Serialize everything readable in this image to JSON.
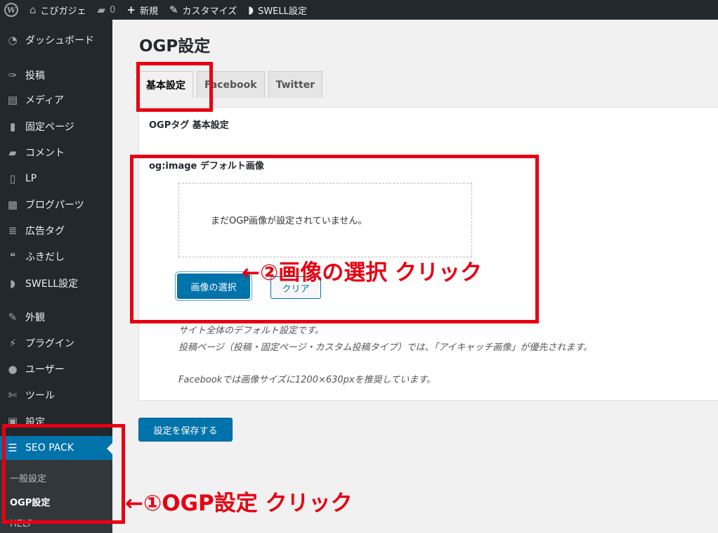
{
  "admin_bar": {
    "site_name": "こびガジェ",
    "comment_count": "0",
    "new_label": "新規",
    "customize_label": "カスタマイズ",
    "swell_label": "SWELL設定"
  },
  "sidebar": {
    "items": [
      {
        "label": "ダッシュボード",
        "icon": "dashboard-icon"
      },
      {
        "label": "投稿",
        "icon": "pin-icon"
      },
      {
        "label": "メディア",
        "icon": "media-icon"
      },
      {
        "label": "固定ページ",
        "icon": "page-icon"
      },
      {
        "label": "コメント",
        "icon": "comment-icon"
      },
      {
        "label": "LP",
        "icon": "document-icon"
      },
      {
        "label": "ブログパーツ",
        "icon": "grid-icon"
      },
      {
        "label": "広告タグ",
        "icon": "stack-icon"
      },
      {
        "label": "ふきだし",
        "icon": "speech-bubble-icon"
      },
      {
        "label": "SWELL設定",
        "icon": "swell-icon"
      },
      {
        "label": "外観",
        "icon": "brush-icon"
      },
      {
        "label": "プラグイン",
        "icon": "plug-icon"
      },
      {
        "label": "ユーザー",
        "icon": "user-icon"
      },
      {
        "label": "ツール",
        "icon": "wrench-icon"
      },
      {
        "label": "設定",
        "icon": "settings-icon"
      }
    ],
    "active_item": {
      "label": "SEO PACK",
      "icon": "list-icon"
    },
    "submenu": [
      {
        "label": "一般設定"
      },
      {
        "label": "OGP設定"
      },
      {
        "label": "HELP"
      }
    ]
  },
  "main": {
    "page_title": "OGP設定",
    "tabs": [
      {
        "label": "基本設定"
      },
      {
        "label": "Facebook"
      },
      {
        "label": "Twitter"
      }
    ],
    "section_title": "OGPタグ 基本設定",
    "field_label": "og:image デフォルト画像",
    "empty_image_text": "まだOGP画像が設定されていません。",
    "select_button": "画像の選択",
    "clear_button": "クリア",
    "description": [
      "サイト全体のデフォルト設定です。",
      "投稿ページ（投稿・固定ページ・カスタム投稿タイプ）では、「アイキャッチ画像」が優先されます。",
      "Facebookでは画像サイズに1200×630pxを推奨しています。"
    ],
    "save_button": "設定を保存する"
  },
  "annotations": {
    "step2": "←②画像の選択 クリック",
    "step1": "←①OGP設定 クリック",
    "color": "#e60012"
  }
}
